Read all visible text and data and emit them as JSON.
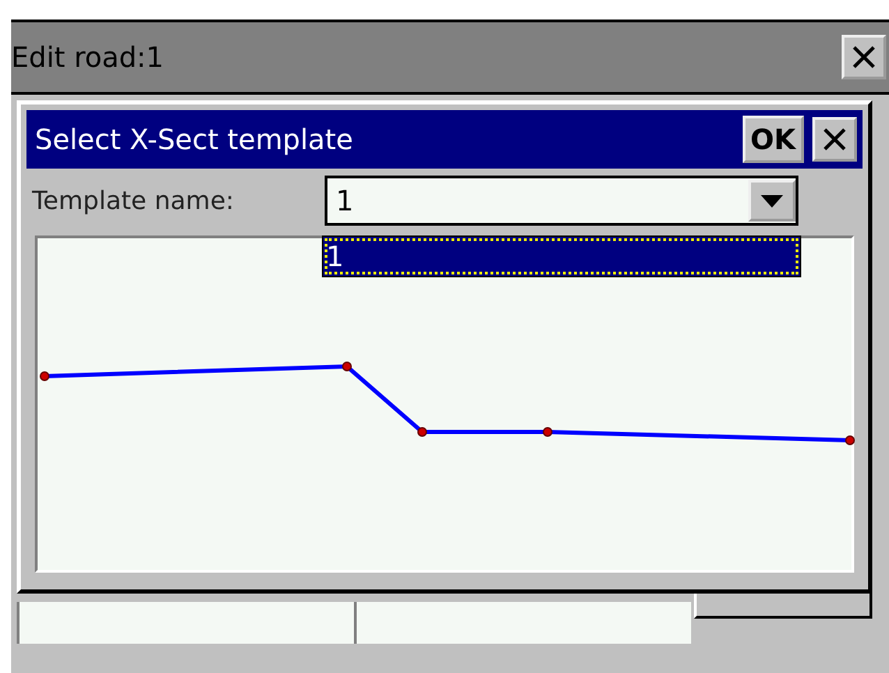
{
  "window": {
    "title": "Edit road:1"
  },
  "dialog": {
    "title": "Select X-Sect template",
    "ok_label": "OK",
    "template_label": "Template name:",
    "template_value": "1",
    "dropdown_items": [
      {
        "label": "1",
        "selected": true
      }
    ]
  }
}
